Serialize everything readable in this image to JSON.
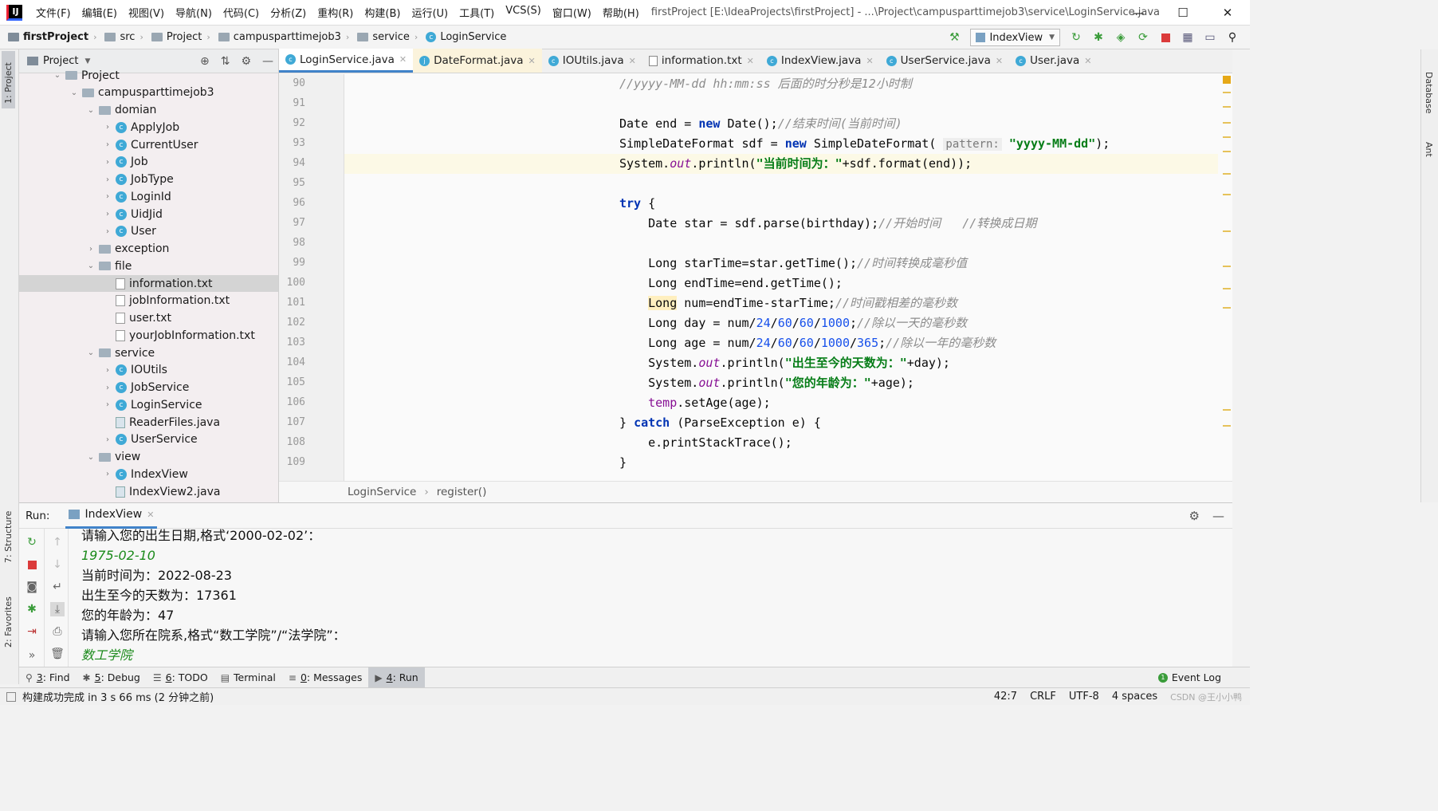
{
  "titlebar": {
    "menus": [
      "文件(F)",
      "编辑(E)",
      "视图(V)",
      "导航(N)",
      "代码(C)",
      "分析(Z)",
      "重构(R)",
      "构建(B)",
      "运行(U)",
      "工具(T)",
      "VCS(S)",
      "窗口(W)",
      "帮助(H)"
    ],
    "title": "firstProject [E:\\IdeaProjects\\firstProject] - ...\\Project\\campusparttimejob3\\service\\LoginService.java",
    "min": "—",
    "max": "☐",
    "close": "✕"
  },
  "breadcrumb": [
    "firstProject",
    "src",
    "Project",
    "campusparttimejob3",
    "service",
    "LoginService"
  ],
  "run_config": "IndexView",
  "left_tabs": [
    "1: Project",
    "7: Structure",
    "2: Favorites"
  ],
  "right_tabs": [
    "Database",
    "Ant"
  ],
  "project": {
    "title": "Project",
    "tree": [
      {
        "label": "Project",
        "depth": 3,
        "kind": "fold",
        "open": true
      },
      {
        "label": "campusparttimejob3",
        "depth": 4,
        "kind": "fold",
        "open": true
      },
      {
        "label": "domian",
        "depth": 5,
        "kind": "fold",
        "open": true
      },
      {
        "label": "ApplyJob",
        "depth": 6,
        "kind": "cls",
        "open": false
      },
      {
        "label": "CurrentUser",
        "depth": 6,
        "kind": "cls",
        "open": false
      },
      {
        "label": "Job",
        "depth": 6,
        "kind": "cls",
        "open": false
      },
      {
        "label": "JobType",
        "depth": 6,
        "kind": "cls",
        "open": false
      },
      {
        "label": "LoginId",
        "depth": 6,
        "kind": "cls",
        "open": false
      },
      {
        "label": "UidJid",
        "depth": 6,
        "kind": "cls",
        "open": false
      },
      {
        "label": "User",
        "depth": 6,
        "kind": "cls",
        "open": false
      },
      {
        "label": "exception",
        "depth": 5,
        "kind": "fold",
        "open": false
      },
      {
        "label": "file",
        "depth": 5,
        "kind": "fold",
        "open": true
      },
      {
        "label": "information.txt",
        "depth": 6,
        "kind": "txt",
        "sel": true
      },
      {
        "label": "jobInformation.txt",
        "depth": 6,
        "kind": "txt"
      },
      {
        "label": "user.txt",
        "depth": 6,
        "kind": "txt"
      },
      {
        "label": "yourJobInformation.txt",
        "depth": 6,
        "kind": "txt"
      },
      {
        "label": "service",
        "depth": 5,
        "kind": "fold",
        "open": true
      },
      {
        "label": "IOUtils",
        "depth": 6,
        "kind": "cls",
        "open": false
      },
      {
        "label": "JobService",
        "depth": 6,
        "kind": "cls",
        "open": false
      },
      {
        "label": "LoginService",
        "depth": 6,
        "kind": "cls",
        "open": false
      },
      {
        "label": "ReaderFiles.java",
        "depth": 6,
        "kind": "jf"
      },
      {
        "label": "UserService",
        "depth": 6,
        "kind": "cls",
        "open": false
      },
      {
        "label": "view",
        "depth": 5,
        "kind": "fold",
        "open": true
      },
      {
        "label": "IndexView",
        "depth": 6,
        "kind": "cls",
        "open": false
      },
      {
        "label": "IndexView2.java",
        "depth": 6,
        "kind": "jf"
      }
    ]
  },
  "tabs": [
    {
      "label": "LoginService.java",
      "icon": "c",
      "active": true
    },
    {
      "label": "DateFormat.java",
      "icon": "j",
      "mod": true
    },
    {
      "label": "IOUtils.java",
      "icon": "c"
    },
    {
      "label": "information.txt",
      "icon": "t"
    },
    {
      "label": "IndexView.java",
      "icon": "c"
    },
    {
      "label": "UserService.java",
      "icon": "c"
    },
    {
      "label": "User.java",
      "icon": "c"
    }
  ],
  "line_numbers": [
    "90",
    "91",
    "92",
    "93",
    "94",
    "95",
    "96",
    "97",
    "98",
    "99",
    "100",
    "101",
    "102",
    "103",
    "104",
    "105",
    "106",
    "107",
    "108",
    "109"
  ],
  "code_lines": [
    [
      {
        "t": "//yyyy-MM-dd hh:mm:ss 后面的时分秒是12小时制",
        "c": "cm"
      }
    ],
    [],
    [
      {
        "t": "Date end = "
      },
      {
        "t": "new",
        "c": "kw"
      },
      {
        "t": " Date();"
      },
      {
        "t": "//结束时间(当前时间)",
        "c": "cm"
      }
    ],
    [
      {
        "t": "SimpleDateFormat sdf = "
      },
      {
        "t": "new",
        "c": "kw"
      },
      {
        "t": " SimpleDateFormat( "
      },
      {
        "t": "pattern:",
        "c": "hint"
      },
      {
        "t": " "
      },
      {
        "t": "\"yyyy-MM-dd\"",
        "c": "st"
      },
      {
        "t": ");"
      }
    ],
    [
      {
        "t": "System."
      },
      {
        "t": "out",
        "c": "fl"
      },
      {
        "t": ".println("
      },
      {
        "t": "\"当前时间为：\"",
        "c": "st"
      },
      {
        "t": "+sdf.format(end));"
      }
    ],
    [],
    [
      {
        "t": "try",
        "c": "kw"
      },
      {
        "t": " {"
      }
    ],
    [
      {
        "t": "    Date star = sdf.parse(birthday);"
      },
      {
        "t": "//开始时间   //转换成日期",
        "c": "cm"
      }
    ],
    [],
    [
      {
        "t": "    Long starTime=star.getTime();"
      },
      {
        "t": "//时间转换成毫秒值",
        "c": "cm"
      }
    ],
    [
      {
        "t": "    Long endTime=end.getTime();"
      }
    ],
    [
      {
        "t": "    "
      },
      {
        "t": "Long",
        "c": "lh"
      },
      {
        "t": " num=endTime-starTime;"
      },
      {
        "t": "//时间戳相差的毫秒数",
        "c": "cm"
      }
    ],
    [
      {
        "t": "    Long day = num/"
      },
      {
        "t": "24",
        "c": "nu"
      },
      {
        "t": "/"
      },
      {
        "t": "60",
        "c": "nu"
      },
      {
        "t": "/"
      },
      {
        "t": "60",
        "c": "nu"
      },
      {
        "t": "/"
      },
      {
        "t": "1000",
        "c": "nu"
      },
      {
        "t": ";"
      },
      {
        "t": "//除以一天的毫秒数",
        "c": "cm"
      }
    ],
    [
      {
        "t": "    Long age = num/"
      },
      {
        "t": "24",
        "c": "nu"
      },
      {
        "t": "/"
      },
      {
        "t": "60",
        "c": "nu"
      },
      {
        "t": "/"
      },
      {
        "t": "60",
        "c": "nu"
      },
      {
        "t": "/"
      },
      {
        "t": "1000",
        "c": "nu"
      },
      {
        "t": "/"
      },
      {
        "t": "365",
        "c": "nu"
      },
      {
        "t": ";"
      },
      {
        "t": "//除以一年的毫秒数",
        "c": "cm"
      }
    ],
    [
      {
        "t": "    System."
      },
      {
        "t": "out",
        "c": "fl"
      },
      {
        "t": ".println("
      },
      {
        "t": "\"出生至今的天数为：\"",
        "c": "st"
      },
      {
        "t": "+day);"
      }
    ],
    [
      {
        "t": "    System."
      },
      {
        "t": "out",
        "c": "fl"
      },
      {
        "t": ".println("
      },
      {
        "t": "\"您的年龄为：\"",
        "c": "st"
      },
      {
        "t": "+age);"
      }
    ],
    [
      {
        "t": "    "
      },
      {
        "t": "temp",
        "c": "lv"
      },
      {
        "t": ".setAge(age);"
      }
    ],
    [
      {
        "t": "} "
      },
      {
        "t": "catch",
        "c": "kw"
      },
      {
        "t": " (ParseException e) {"
      }
    ],
    [
      {
        "t": "    e.printStackTrace();"
      }
    ],
    [
      {
        "t": "}"
      }
    ]
  ],
  "current_line_index": 4,
  "editor_breadcrumb": [
    "LoginService",
    "register()"
  ],
  "run": {
    "label": "Run:",
    "tab": "IndexView",
    "console": [
      {
        "text": "请输入您的出生日期,格式‘2000-02-02’：",
        "input": false
      },
      {
        "text": "1975-02-10",
        "input": true
      },
      {
        "text": "当前时间为：2022-08-23",
        "input": false
      },
      {
        "text": "出生至今的天数为：17361",
        "input": false
      },
      {
        "text": "您的年龄为：47",
        "input": false
      },
      {
        "text": "请输入您所在院系,格式“数工学院”/“法学院”：",
        "input": false
      },
      {
        "text": "数工学院",
        "input": true
      }
    ]
  },
  "toolwindows": [
    {
      "icon": "⚲",
      "key": "3",
      "label": ": Find"
    },
    {
      "icon": "✱",
      "key": "5",
      "label": ": Debug"
    },
    {
      "icon": "☰",
      "key": "6",
      "label": ": TODO"
    },
    {
      "icon": "▤",
      "key": "",
      "label": "Terminal"
    },
    {
      "icon": "≡",
      "key": "0",
      "label": ": Messages"
    },
    {
      "icon": "▶",
      "key": "4",
      "label": ": Run",
      "active": true
    }
  ],
  "event_log": "Event Log",
  "status": {
    "message": "构建成功完成 in 3 s 66 ms (2 分钟之前)",
    "position": "42:7",
    "line_sep": "CRLF",
    "encoding": "UTF-8",
    "indent": "4 spaces",
    "watermark": "CSDN @王小小鸭"
  }
}
